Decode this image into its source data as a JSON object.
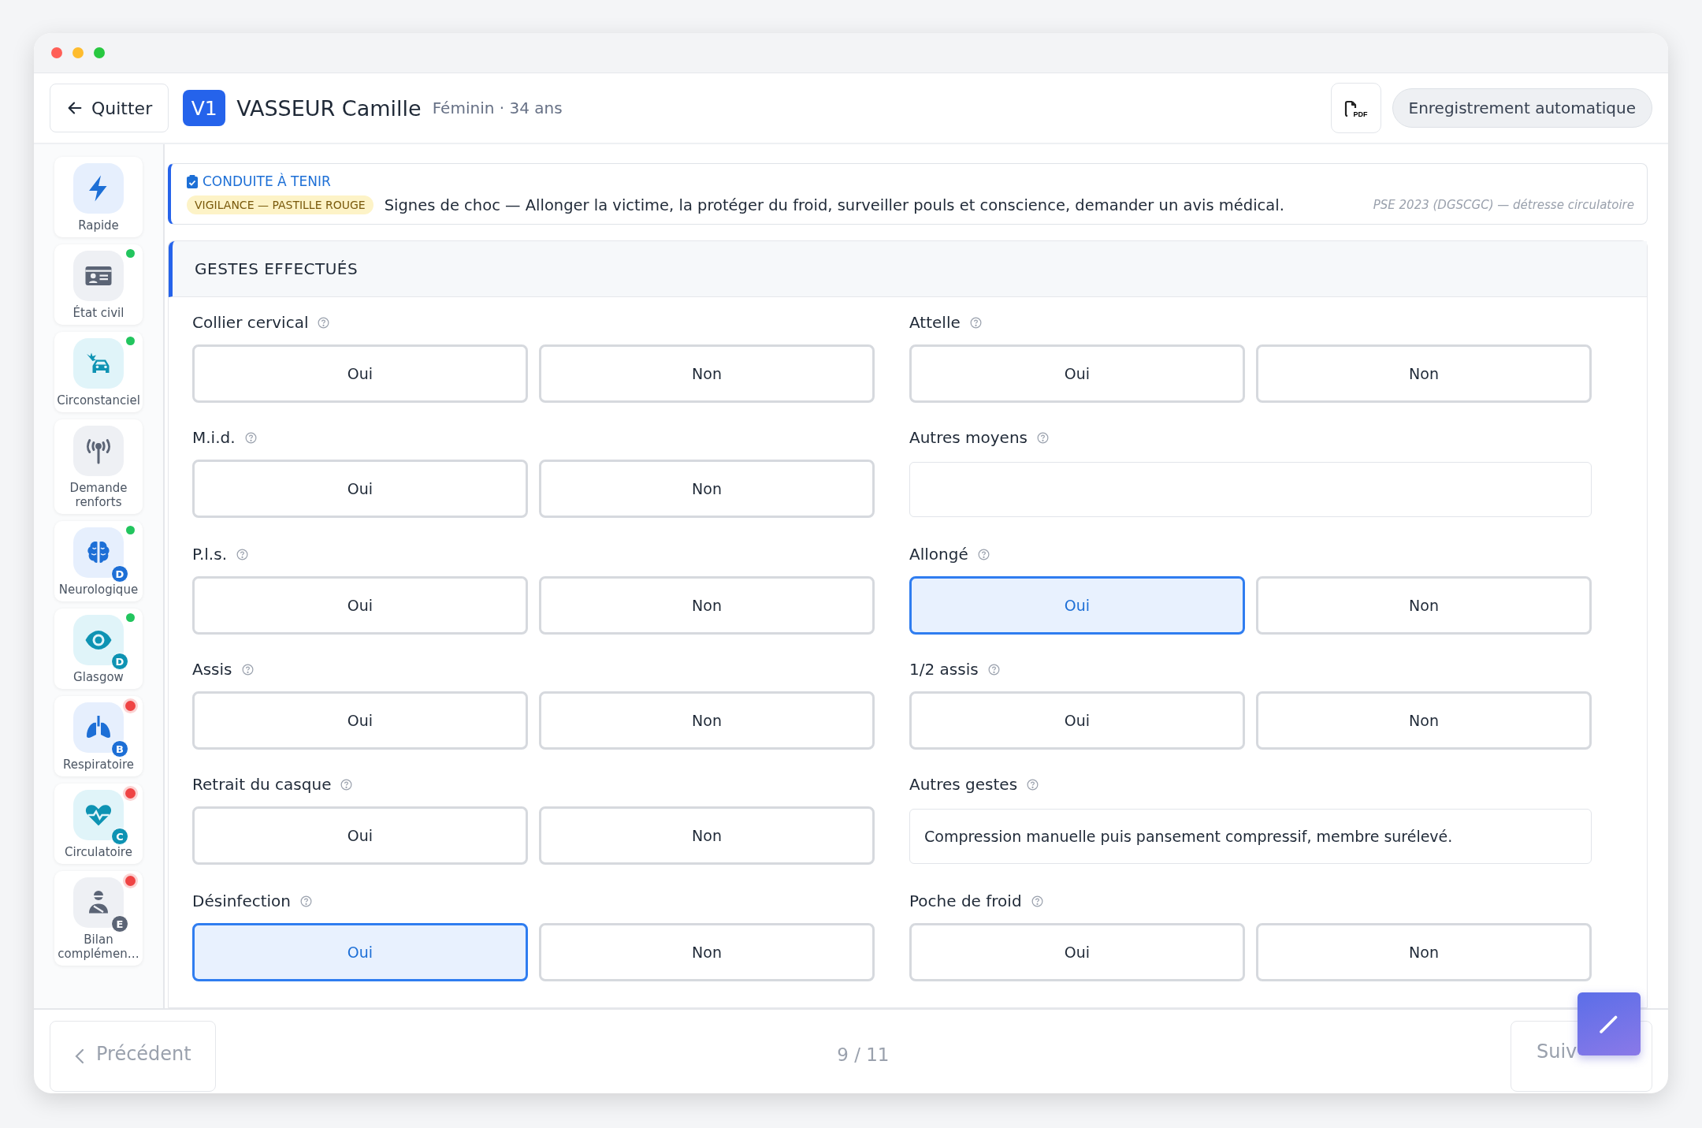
{
  "header": {
    "back_button": {
      "label": "Quitter"
    },
    "visit_badge": "V1",
    "patient_name": "VASSEUR Camille",
    "patient_info": "Féminin · 34 ans",
    "export_button": {
      "label": "PDF"
    },
    "autosave": "Enregistrement automatique"
  },
  "sidebar": {
    "items": [
      {
        "label": "Rapide",
        "kind": "bolt",
        "selected": false
      },
      {
        "label": "État civil",
        "kind": "idcard",
        "color": "#22c55e",
        "flagged": false,
        "selected": false
      },
      {
        "label": "Circonstanciel",
        "kind": "car",
        "color": "#22c55e",
        "flagged": false,
        "selected": false
      },
      {
        "label": "Demande renforts",
        "kind": "antenna",
        "selected": false
      },
      {
        "label": "Neurologique",
        "kind": "brain",
        "color": "#22c55e",
        "flagged": false,
        "badge": "D",
        "selected": false
      },
      {
        "label": "Glasgow",
        "kind": "eye",
        "color": "#22c55e",
        "flagged": false,
        "badge": "D",
        "selected": false
      },
      {
        "label": "Respiratoire",
        "kind": "lungs",
        "color": "#ef4444",
        "flagged": true,
        "badge": "B",
        "selected": false
      },
      {
        "label": "Circulatoire",
        "kind": "heart",
        "color": "#ef4444",
        "flagged": true,
        "badge": "C",
        "selected": false
      },
      {
        "label": "Bilan complémen…",
        "kind": "person",
        "color": "#ef4444",
        "flagged": true,
        "badge": "E",
        "selected": false
      }
    ]
  },
  "alert": {
    "title": "CONDUITE À TENIR",
    "tag": "VIGILANCE — PASTILLE ROUGE",
    "message": "Signes de choc — Allonger la victime, la protéger du froid, surveiller pouls et conscience, demander un avis médical.",
    "source": "PSE 2023 (DGSCGC) — détresse circulatoire"
  },
  "section": {
    "title": "GESTES EFFECTUÉS",
    "fields": [
      {
        "kind": "yesno",
        "label": "Collier cervical",
        "options": [
          {
            "label": "Oui",
            "selected": false
          },
          {
            "label": "Non",
            "selected": false
          }
        ]
      },
      {
        "kind": "yesno",
        "label": "Attelle",
        "options": [
          {
            "label": "Oui",
            "selected": false
          },
          {
            "label": "Non",
            "selected": false
          }
        ]
      },
      {
        "kind": "yesno",
        "label": "M.i.d.",
        "options": [
          {
            "label": "Oui",
            "selected": false
          },
          {
            "label": "Non",
            "selected": false
          }
        ]
      },
      {
        "kind": "text",
        "label": "Autres moyens"
      },
      {
        "kind": "yesno",
        "label": "P.l.s.",
        "options": [
          {
            "label": "Oui",
            "selected": false
          },
          {
            "label": "Non",
            "selected": false
          }
        ]
      },
      {
        "kind": "yesno",
        "label": "Allongé",
        "options": [
          {
            "label": "Oui",
            "selected": true
          },
          {
            "label": "Non",
            "selected": false
          }
        ]
      },
      {
        "kind": "yesno",
        "label": "Assis",
        "options": [
          {
            "label": "Oui",
            "selected": false
          },
          {
            "label": "Non",
            "selected": false
          }
        ]
      },
      {
        "kind": "yesno",
        "label": "1/2 assis",
        "options": [
          {
            "label": "Oui",
            "selected": false
          },
          {
            "label": "Non",
            "selected": false
          }
        ]
      },
      {
        "kind": "yesno",
        "label": "Retrait du casque",
        "options": [
          {
            "label": "Oui",
            "selected": false
          },
          {
            "label": "Non",
            "selected": false
          }
        ]
      },
      {
        "kind": "text",
        "label": "Autres gestes",
        "value": "Compression manuelle puis pansement compressif, membre surélevé."
      },
      {
        "kind": "yesno",
        "label": "Désinfection",
        "options": [
          {
            "label": "Oui",
            "selected": true
          },
          {
            "label": "Non",
            "selected": false
          }
        ]
      },
      {
        "kind": "yesno",
        "label": "Poche de froid",
        "options": [
          {
            "label": "Oui",
            "selected": false
          },
          {
            "label": "Non",
            "selected": false
          }
        ]
      }
    ]
  },
  "footer": {
    "previous": "Précédent",
    "page": "9 / 11",
    "next": "Suiv"
  }
}
